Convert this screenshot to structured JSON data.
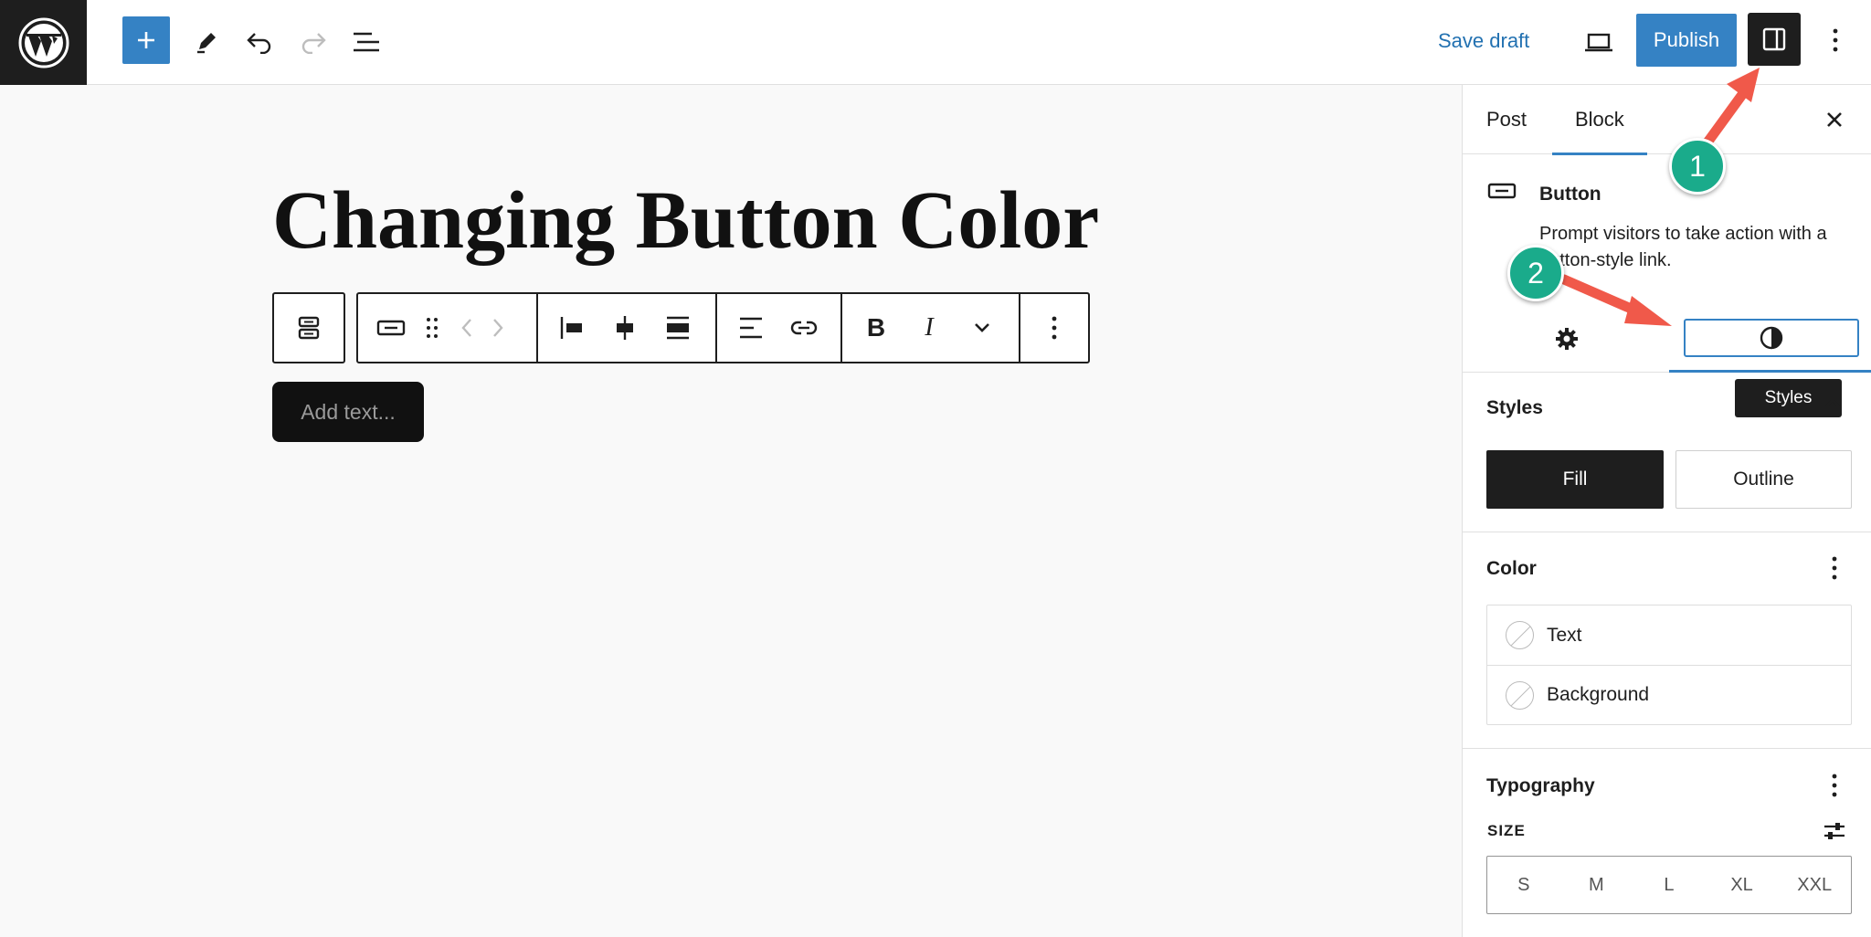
{
  "topbar": {
    "logo_icon": "wordpress-logo-icon",
    "save_draft": "Save draft",
    "publish": "Publish",
    "icons": [
      "plus-icon",
      "pencil-icon",
      "undo-icon",
      "redo-icon",
      "list-view-icon",
      "desktop-preview-icon",
      "sidebar-toggle-icon",
      "more-vertical-icon"
    ],
    "accent_color": "#3582c4"
  },
  "editor": {
    "post_title": "Changing Button Color",
    "button_placeholder": "Add text...",
    "toolbar_icons": [
      "buttons-block-icon",
      "button-block-icon",
      "drag-handle-icon",
      "move-arrows-icon",
      "justify-left-icon",
      "justify-center-icon",
      "justify-stretch-icon",
      "align-text-icon",
      "link-icon",
      "bold-icon",
      "italic-icon",
      "chevron-down-icon",
      "more-vertical-icon"
    ],
    "bold_glyph": "B",
    "italic_glyph": "I"
  },
  "sidebar": {
    "tabs": [
      "Post",
      "Block"
    ],
    "active_tab": "Block",
    "block_card": {
      "title": "Button",
      "description": "Prompt visitors to take action with a button-style link."
    },
    "styles_tooltip": "Styles",
    "styles_panel": {
      "title": "Styles",
      "options": [
        "Fill",
        "Outline"
      ],
      "selected": "Fill"
    },
    "color_panel": {
      "title": "Color",
      "items": [
        "Text",
        "Background"
      ]
    },
    "typography_panel": {
      "title": "Typography",
      "size_label": "SIZE",
      "sizes": [
        "S",
        "M",
        "L",
        "XL",
        "XXL"
      ]
    }
  },
  "annotations": {
    "badge_1": "1",
    "badge_2": "2",
    "arrow_color": "#f0594a",
    "badge_color": "#1aab8b"
  }
}
